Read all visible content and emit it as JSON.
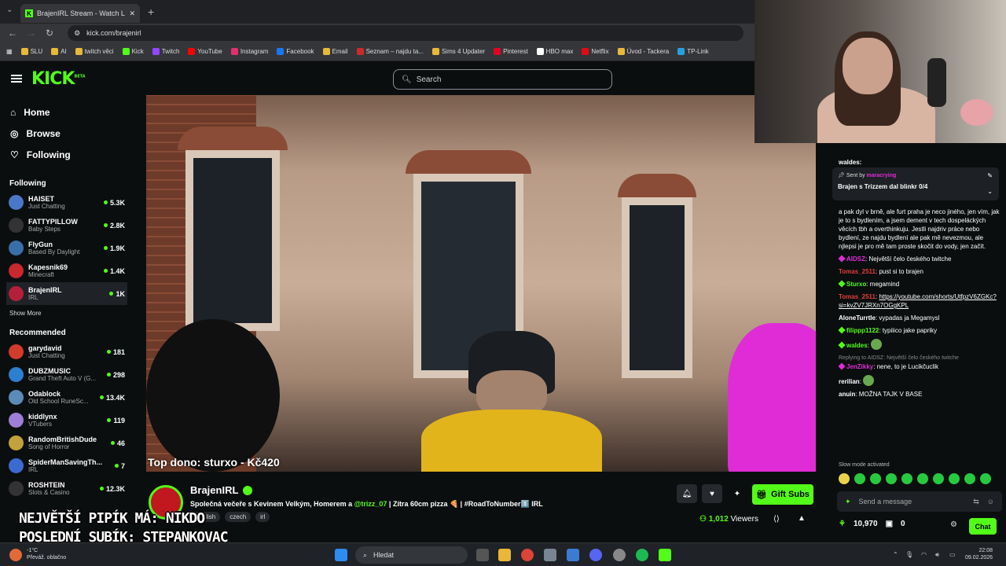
{
  "browser": {
    "tab_title": "BrajenIRL Stream - Watch L...",
    "url": "kick.com/brajenirl",
    "bookmarks": [
      "SLU",
      "AI",
      "twitch věci",
      "Kick",
      "Twitch",
      "YouTube",
      "Instagram",
      "Facebook",
      "Email",
      "Seznam – najdu ta...",
      "Sims 4 Updater",
      "Pinterest",
      "HBO max",
      "Netflix",
      "Úvod - Tackera",
      "TP-Link"
    ]
  },
  "header": {
    "logo": "KICK",
    "logo_beta": "BETA",
    "search_placeholder": "Search"
  },
  "sidebar": {
    "nav": [
      {
        "label": "Home",
        "icon": "home-icon"
      },
      {
        "label": "Browse",
        "icon": "compass-icon"
      },
      {
        "label": "Following",
        "icon": "heart-icon"
      }
    ],
    "following_title": "Following",
    "following": [
      {
        "name": "HAISET",
        "category": "Just Chatting",
        "viewers": "5.3K",
        "color": "#4a78c8"
      },
      {
        "name": "FATTYPILLOW",
        "category": "Baby Steps",
        "viewers": "2.8K",
        "color": "#333333"
      },
      {
        "name": "FlyGun",
        "category": "Based By Daylight",
        "viewers": "1.9K",
        "color": "#3a6ea8"
      },
      {
        "name": "Kapesnik69",
        "category": "Minecraft",
        "viewers": "1.4K",
        "color": "#c8282e"
      },
      {
        "name": "BrajenIRL",
        "category": "IRL",
        "viewers": "1K",
        "color": "#b41f3c"
      }
    ],
    "show_more": "Show More",
    "recommended_title": "Recommended",
    "recommended": [
      {
        "name": "garydavid",
        "category": "Just Chatting",
        "viewers": "181",
        "color": "#d33b2c"
      },
      {
        "name": "DUBZMUSIC",
        "category": "Grand Theft Auto V (G...",
        "viewers": "298",
        "color": "#2d7fd0"
      },
      {
        "name": "Odablock",
        "category": "Old School RuneSc...",
        "viewers": "13.4K",
        "color": "#5b8bb8"
      },
      {
        "name": "kiddlynx",
        "category": "VTubers",
        "viewers": "119",
        "color": "#9d7fd8"
      },
      {
        "name": "RandomBritishDude",
        "category": "Song of Horror",
        "viewers": "46",
        "color": "#c2a23a"
      },
      {
        "name": "SpiderManSavingTh...",
        "category": "IRL",
        "viewers": "7",
        "color": "#3c6ad0"
      },
      {
        "name": "ROSHTEIN",
        "category": "Slots & Casino",
        "viewers": "12.3K",
        "color": "#333333"
      }
    ]
  },
  "video": {
    "top_dono": "Top dono: sturxo - Kč420"
  },
  "overlay": {
    "line1": "NEJVĚTŠÍ PIPÍK MÁ: NIKDO",
    "line2": "POSLEDNÍ SUBÍK: STEPANKOVAC"
  },
  "stream": {
    "name": "BrajenIRL",
    "title_before": "Společná večeře s Kevinem Velkým, Homerem a ",
    "title_mention": "@trizz_07",
    "title_after": " | Zítra 60cm pizza 🍕 | #RoadToNumber1️⃣ IRL",
    "tags": [
      "English",
      "czech",
      "irl"
    ],
    "gift_label": "Gift Subs",
    "viewers": "1,012",
    "viewers_label": "Viewers"
  },
  "chat": {
    "pinned_sent_by": "Sent by",
    "pinned_user": "maracrying",
    "pinned_text": "Brajen s Trizzem dal blinkr 0/4",
    "top_user": "waldes:",
    "messages": [
      {
        "user": "",
        "color": "#ffffff",
        "text": "a pak dyl v brně, ale furt praha je neco jiného, jen vím, jak je to s bydlením, a jsem dement v tech dospeláckých věcích tbh a overthinkuju. Jestli najdriv práce nebo bydlení, ze najdu bydlení ale pak mě nevezmou, ale njlepsi je pro mě tam proste skočit do vody, jen začít."
      },
      {
        "user": "AIDSZ",
        "color": "#e02cd7",
        "text": "Největší čelo českého twitche"
      },
      {
        "user": "Tomas_2511",
        "color": "#e0403a",
        "text": "pust si to brajen"
      },
      {
        "user": "Sturxo",
        "color": "#53fc18",
        "text": "megamind"
      },
      {
        "user": "Tomas_2511",
        "color": "#e0403a",
        "text": "https://youtube.com/shorts/UtfpzV6ZGKc?si=kvZV7JRXn7OGgKPL"
      },
      {
        "user": "AloneTurrtle",
        "color": "#ffffff",
        "text": "vypadas ja Megamysl"
      },
      {
        "user": "filippp1122",
        "color": "#53fc18",
        "text": "typiiico jake papriky"
      },
      {
        "user": "waldes",
        "color": "#53fc18",
        "text": ""
      },
      {
        "user": "JenZikky",
        "color": "#e02cd7",
        "text": "nene, to je Lucikčuclik",
        "reply": "Replying to AIDSZ: Největší čelo českého twitche"
      },
      {
        "user": "rerilian",
        "color": "#ffffff",
        "text": ""
      },
      {
        "user": "anuin",
        "color": "#ffffff",
        "text": "MOŽNA TAJK V BASE"
      }
    ],
    "slow_mode": "Slow mode activated",
    "input_placeholder": "Send a message",
    "points": "10,970",
    "gift_count": "0",
    "chat_button": "Chat"
  },
  "taskbar": {
    "weather_temp": "-1°C",
    "weather_desc": "Převáž. oblačno",
    "search": "Hledat",
    "time": "22:08",
    "date": "09.02.2026"
  }
}
